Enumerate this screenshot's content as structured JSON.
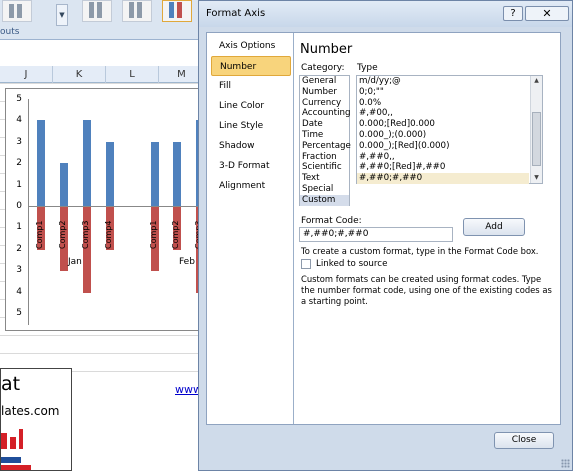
{
  "ribbon": {
    "group_label": "outs",
    "gallery_scroll_icon": "chevron-down-icon"
  },
  "sheet": {
    "columns": [
      "J",
      "K",
      "L",
      "M"
    ],
    "link_text": "www"
  },
  "chart_data": {
    "type": "bar",
    "y_ticks": [
      "5",
      "4",
      "3",
      "2",
      "1",
      "0",
      "1",
      "2",
      "3",
      "4",
      "5"
    ],
    "ylim": [
      -5,
      5
    ],
    "groups": [
      "Jan",
      "Feb"
    ],
    "categories": [
      "Comp1",
      "Comp2",
      "Comp3",
      "Comp4",
      "Comp1",
      "Comp2",
      "Comp3"
    ],
    "series": [
      {
        "values": [
          4,
          2,
          4,
          3,
          3,
          3,
          4
        ]
      },
      {
        "values": [
          -2,
          -3,
          -4,
          -2,
          -3,
          -2,
          -4
        ]
      }
    ],
    "colors": {
      "positive": "#4F81BD",
      "negative": "#C0504D"
    }
  },
  "logo": {
    "line1": "at",
    "line2": "lates.com",
    "logo_mark": "excel-logo-graphic"
  },
  "dialog": {
    "title": "Format Axis",
    "help_icon": "question-icon",
    "close_icon": "close-icon",
    "nav": [
      "Axis Options",
      "Number",
      "Fill",
      "Line Color",
      "Line Style",
      "Shadow",
      "3-D Format",
      "Alignment"
    ],
    "selected_nav": "Number",
    "pane_title": "Number",
    "category_label": "Category:",
    "type_label": "Type",
    "categories": [
      "General",
      "Number",
      "Currency",
      "Accounting",
      "Date",
      "Time",
      "Percentage",
      "Fraction",
      "Scientific",
      "Text",
      "Special",
      "Custom"
    ],
    "selected_category": "Custom",
    "types": [
      "m/d/yy;@",
      "0;0;\"\"",
      "0.0%",
      "#,#00,,",
      "0.000;[Red]0.000",
      "0.000_);(0.000)",
      "0.000_);[Red](0.000)",
      "#,##0,,",
      "#,##0;[Red]#,##0",
      "#,##0;#,##0"
    ],
    "selected_type": "#,##0;#,##0",
    "format_code_label": "Format Code:",
    "format_code_value": "#,##0;#,##0",
    "add_label": "Add",
    "help_text": "To create a custom format, type in the Format Code box.",
    "linked_label": "Linked to source",
    "linked_checked": false,
    "description": "Custom formats can be created using format codes.  Type the number format code, using one of the existing codes as a starting point.",
    "close_label": "Close"
  }
}
